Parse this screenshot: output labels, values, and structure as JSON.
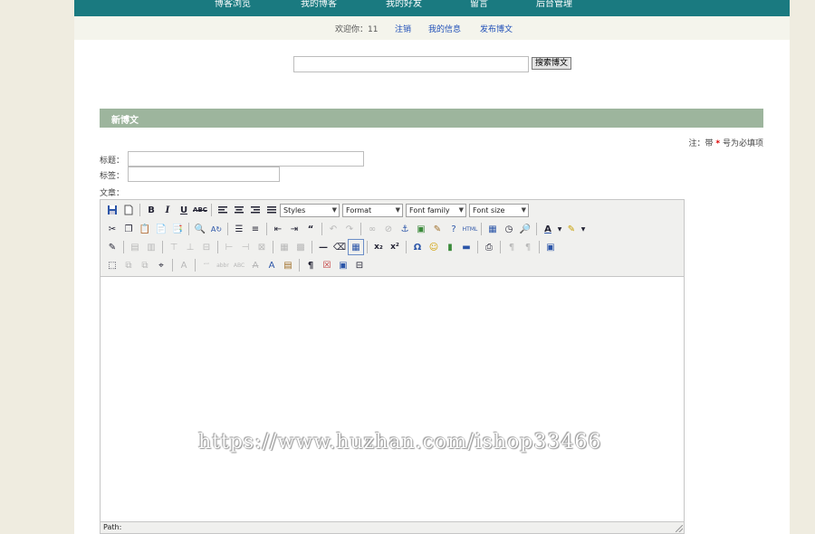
{
  "nav": {
    "items": [
      {
        "label": "博客浏览"
      },
      {
        "label": "我的博客"
      },
      {
        "label": "我的好友"
      },
      {
        "label": "留言"
      },
      {
        "label": "后台管理"
      }
    ]
  },
  "subnav": {
    "welcome": "欢迎你：11",
    "logout": "注销",
    "myinfo": "我的信息",
    "publish": "发布博文"
  },
  "search": {
    "value": "",
    "button": "搜索博文"
  },
  "section": {
    "title": "新博文"
  },
  "note": {
    "prefix": "注：带",
    "star": "*",
    "suffix": "号为必填项"
  },
  "form": {
    "title_label": "标题：",
    "title_value": "",
    "tags_label": "标签：",
    "tags_value": "",
    "content_label": "文章："
  },
  "editor": {
    "selects": {
      "styles": "Styles",
      "format": "Format",
      "font_family": "Font family",
      "font_size": "Font size"
    },
    "path_label": "Path:"
  },
  "watermark": "https://www.huzhan.com/ishop33466"
}
